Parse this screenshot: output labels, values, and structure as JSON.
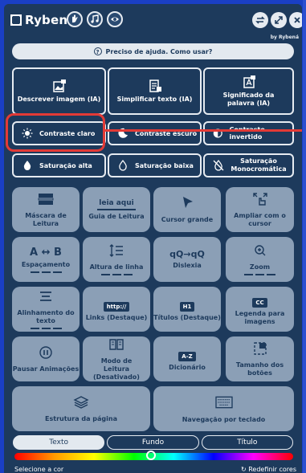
{
  "brand": {
    "name": "Rybená",
    "byline": "by Rybená"
  },
  "help": {
    "label": "Preciso de ajuda. Como usar?"
  },
  "ai_buttons": [
    {
      "label": "Descrever imagem (IA)",
      "icon": "image-ai-icon"
    },
    {
      "label": "Simplificar texto (IA)",
      "icon": "document-ai-icon"
    },
    {
      "label": "Significado da palavra (IA)",
      "icon": "dictionary-ai-icon"
    }
  ],
  "contrast": [
    {
      "label": "Contraste claro",
      "icon": "sun-icon"
    },
    {
      "label": "Contraste escuro",
      "icon": "moon-icon"
    },
    {
      "label": "Contraste invertido",
      "icon": "half-circle-icon"
    }
  ],
  "saturation": [
    {
      "label": "Saturação alta",
      "icon": "drop-filled-icon"
    },
    {
      "label": "Saturação baixa",
      "icon": "drop-outline-icon"
    },
    {
      "label": "Saturação Monocromática",
      "icon": "drop-slash-icon"
    }
  ],
  "tools": [
    {
      "label": "Máscara de Leitura",
      "icon": "reading-mask-icon"
    },
    {
      "label": "Guia de Leitura",
      "icon": "reading-guide-icon",
      "icon_text": "leia aqui"
    },
    {
      "label": "Cursor grande",
      "icon": "cursor-icon"
    },
    {
      "label": "Ampliar com o cursor",
      "icon": "magnify-cursor-icon"
    },
    {
      "label": "Espaçamento",
      "icon": "spacing-icon",
      "icon_text": "A ↔ B"
    },
    {
      "label": "Altura de linha",
      "icon": "line-height-icon"
    },
    {
      "label": "Dislexia",
      "icon": "dyslexia-icon",
      "icon_text": "qQ→qQ"
    },
    {
      "label": "Zoom",
      "icon": "zoom-icon"
    },
    {
      "label": "Alinhamento do texto",
      "icon": "text-align-icon"
    },
    {
      "label": "Links (Destaque)",
      "icon": "link-icon",
      "icon_text": "http://"
    },
    {
      "label": "Títulos (Destaque)",
      "icon": "heading-icon",
      "icon_text": "H1"
    },
    {
      "label": "Legenda para imagens",
      "icon": "caption-icon",
      "icon_text": "CC"
    },
    {
      "label": "Pausar Animações",
      "icon": "pause-icon"
    },
    {
      "label": "Modo de Leitura (Desativado)",
      "icon": "book-icon"
    },
    {
      "label": "Dicionário",
      "icon": "dictionary-icon",
      "icon_text": "A-Z"
    },
    {
      "label": "Tamanho dos botões",
      "icon": "resize-icon"
    },
    {
      "label": "Estrutura da página",
      "icon": "layers-icon"
    },
    {
      "label": "Navegação por teclado",
      "icon": "keyboard-icon"
    }
  ],
  "color_tabs": [
    "Texto",
    "Fundo",
    "Título"
  ],
  "footer": {
    "left": "Selecione a cor",
    "right": "Redefinir cores"
  },
  "colors": {
    "panel": "#1d3a5c",
    "tile": "#8b9fb6",
    "highlight": "#e33a36",
    "background": "#1a3fc4"
  }
}
